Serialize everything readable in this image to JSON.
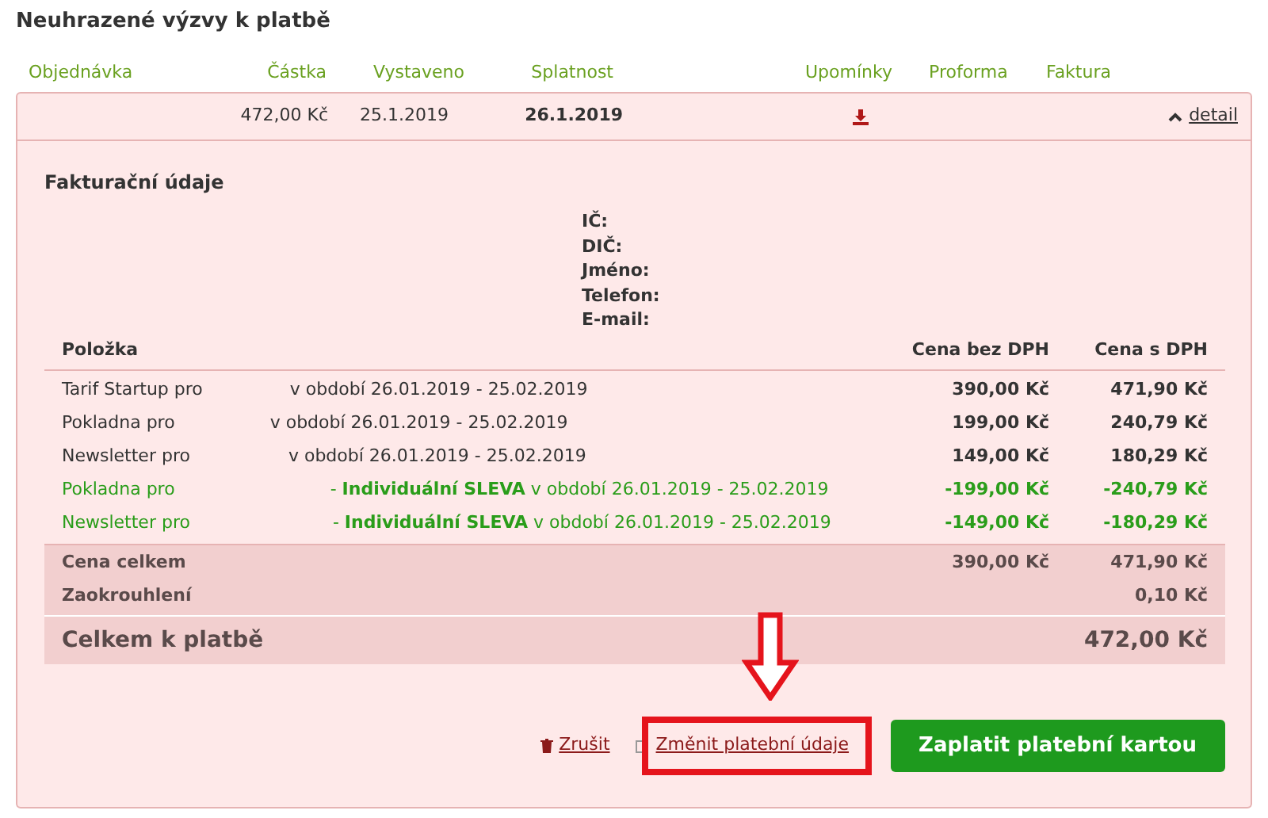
{
  "title": "Neuhrazené výzvy k platbě",
  "columns": [
    "Objednávka",
    "Částka",
    "Vystaveno",
    "Splatnost",
    "Upomínky",
    "Proforma",
    "Faktura"
  ],
  "order": {
    "amount": "472,00 Kč",
    "issued": "25.1.2019",
    "due": "26.1.2019",
    "expanded": true,
    "detail_link": "detail"
  },
  "billing": {
    "heading": "Fakturační údaje",
    "labels": [
      "IČ:",
      "DIČ:",
      "Jméno:",
      "Telefon:",
      "E-mail:"
    ]
  },
  "items_table": {
    "columns": [
      "Položka",
      "Cena bez DPH",
      "Cena s DPH"
    ],
    "rows": [
      {
        "kind": "regular",
        "name": "Tarif Startup pro",
        "description": "v období 26.01.2019 - 25.02.2019",
        "net": "390,00 Kč",
        "gross": "471,90 Kč"
      },
      {
        "kind": "regular",
        "name": "Pokladna pro",
        "description": "v období 26.01.2019 - 25.02.2019",
        "net": "199,00 Kč",
        "gross": "240,79 Kč"
      },
      {
        "kind": "regular",
        "name": "Newsletter pro",
        "description": "v období 26.01.2019 - 25.02.2019",
        "net": "149,00 Kč",
        "gross": "180,29 Kč"
      },
      {
        "kind": "discount",
        "name": "Pokladna pro",
        "description": "- **Individuální SLEVA** v období 26.01.2019 - 25.02.2019",
        "net": "-199,00 Kč",
        "gross": "-240,79 Kč"
      },
      {
        "kind": "discount",
        "name": "Newsletter pro",
        "description": "- **Individuální SLEVA** v období 26.01.2019 - 25.02.2019",
        "net": "-149,00 Kč",
        "gross": "-180,29 Kč"
      }
    ],
    "totals": [
      {
        "label": "Cena celkem",
        "net": "390,00 Kč",
        "gross": "471,90 Kč"
      },
      {
        "label": "Zaokrouhlení",
        "gross": "0,10 Kč"
      }
    ],
    "grand_total": {
      "label": "Celkem k platbě",
      "value": "472,00 Kč"
    }
  },
  "actions": {
    "cancel": "Zrušit",
    "change": "Změnit platební údaje",
    "pay": "Zaplatit platební kartou"
  }
}
